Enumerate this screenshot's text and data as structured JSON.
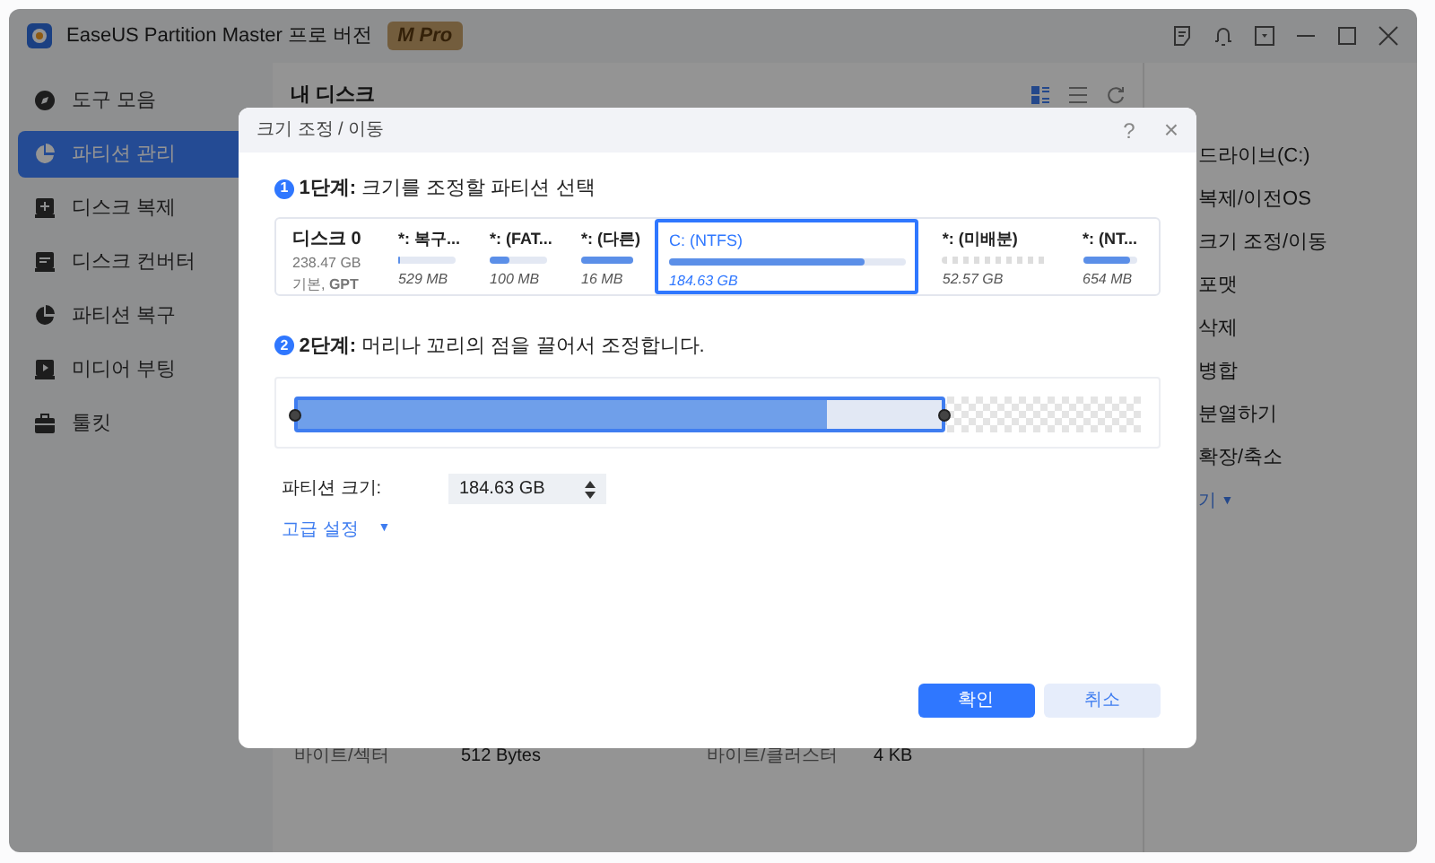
{
  "window": {
    "title": "EaseUS Partition Master 프로 버전",
    "badge_letter": "M",
    "badge": "Pro"
  },
  "sidebar": {
    "items": [
      {
        "label": "도구 모음",
        "selected": false
      },
      {
        "label": "파티션 관리",
        "selected": true
      },
      {
        "label": "디스크 복제",
        "selected": false
      },
      {
        "label": "디스크 컨버터",
        "selected": false
      },
      {
        "label": "파티션 복구",
        "selected": false
      },
      {
        "label": "미디어 부팅",
        "selected": false
      },
      {
        "label": "툴킷",
        "selected": false
      }
    ]
  },
  "main": {
    "title": "내 디스크",
    "details": [
      {
        "label": "바이트/섹터",
        "value": "512 Bytes"
      },
      {
        "label": "바이트/클러스터",
        "value": "4 KB"
      }
    ]
  },
  "operations": {
    "items": [
      "드라이브(C:)",
      "복제/이전OS",
      "크기 조정/이동",
      "포맷",
      "삭제",
      "병합",
      "분열하기",
      "확장/축소"
    ],
    "more": "기",
    "more_arrow": "▼"
  },
  "dialog": {
    "title": "크기 조정 / 이동",
    "help": "?",
    "close": "×",
    "step1": {
      "number": "1",
      "label": "1단계:",
      "text": "크기를 조정할 파티션 선택"
    },
    "disk": {
      "name": "디스크 0",
      "size": "238.47 GB",
      "type": "기본, **GPT**"
    },
    "partitions": [
      {
        "name": "*: 복구...",
        "size": "529 MB",
        "kind": "used",
        "level": 0.03,
        "selected": false
      },
      {
        "name": "*: (FAT...",
        "size": "100 MB",
        "kind": "used",
        "level": 0.33,
        "selected": false
      },
      {
        "name": "*: (다른)",
        "size": "16 MB",
        "kind": "used",
        "level": 1,
        "selected": false
      },
      {
        "name": "C: (NTFS)",
        "size": "184.63 GB",
        "kind": "used",
        "level": 0.82,
        "selected": true
      },
      {
        "name": "*: (미배분)",
        "size": "52.57 GB",
        "kind": "unallocated",
        "selected": false
      },
      {
        "name": "*: (NT...",
        "size": "654 MB",
        "kind": "used",
        "level": 0.86,
        "selected": false
      }
    ],
    "step2": {
      "number": "2",
      "label": "2단계:",
      "text": "머리나 꼬리의 점을 끌어서 조정합니다."
    },
    "resize": {
      "extent": {
        "level": 0.77
      },
      "used": {
        "level": 0.82
      }
    },
    "size_field": {
      "label": "파티션 크기:",
      "value": "184.63 GB"
    },
    "advanced": {
      "label": "고급 설정",
      "arrow": "▼"
    },
    "buttons": [
      {
        "label": "확인",
        "kind": "primary"
      },
      {
        "label": "취소",
        "kind": "secondary"
      }
    ]
  }
}
